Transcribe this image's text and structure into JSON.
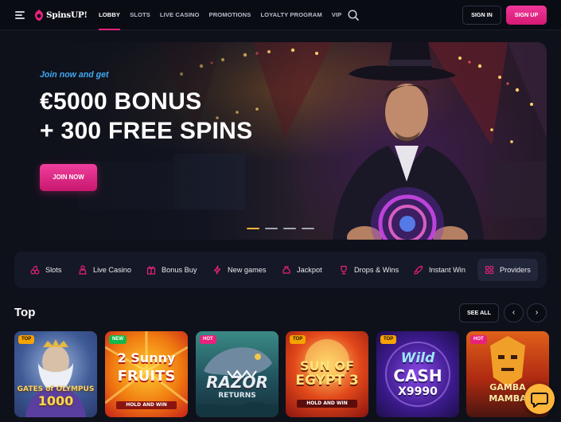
{
  "header": {
    "logo_text": "SpinsUP!",
    "nav": [
      {
        "label": "LOBBY",
        "active": true
      },
      {
        "label": "SLOTS",
        "active": false
      },
      {
        "label": "LIVE CASINO",
        "active": false
      },
      {
        "label": "PROMOTIONS",
        "active": false
      },
      {
        "label": "LOYALTY PROGRAM",
        "active": false
      },
      {
        "label": "VIP",
        "active": false
      }
    ],
    "signin_label": "SIGN IN",
    "signup_label": "SIGN UP",
    "accent_color": "#e8217c"
  },
  "hero": {
    "kicker": "Join now and get",
    "title_line1": "€5000 BONUS",
    "title_line2": "+ 300 FREE SPINS",
    "cta_label": "JOIN NOW",
    "slides_total": 4,
    "active_slide": 1
  },
  "categories": [
    {
      "label": "Slots",
      "icon": "cherries-icon"
    },
    {
      "label": "Live Casino",
      "icon": "dealer-icon"
    },
    {
      "label": "Bonus Buy",
      "icon": "gift-icon"
    },
    {
      "label": "New games",
      "icon": "lightning-icon"
    },
    {
      "label": "Jackpot",
      "icon": "jackpot-bag-icon"
    },
    {
      "label": "Drops & Wins",
      "icon": "trophy-icon"
    },
    {
      "label": "Instant Win",
      "icon": "rocket-icon"
    },
    {
      "label": "Providers",
      "icon": "grid-icon"
    }
  ],
  "top_section": {
    "title": "Top",
    "see_all_label": "SEE ALL",
    "prev_label": "‹",
    "next_label": "›",
    "games": [
      {
        "badge": "TOP",
        "title_line1": "GATES of OLYMPUS",
        "title_line2": "1000"
      },
      {
        "badge": "NEW",
        "title_line1": "2 Sunny",
        "title_line2": "FRUITS",
        "subtitle": "HOLD AND WIN"
      },
      {
        "badge": "HOT",
        "title_line1": "RAZOR",
        "title_line2": "RETURNS"
      },
      {
        "badge": "TOP",
        "title_line1": "SUN OF",
        "title_line2": "EGYPT 3",
        "subtitle": "HOLD AND WIN"
      },
      {
        "badge": "TOP",
        "title_line1": "Wild",
        "title_line2": "CASH",
        "subtitle": "X9990"
      },
      {
        "badge": "HOT",
        "title_line1": "GAMBA",
        "title_line2": "MAMBA"
      }
    ]
  }
}
